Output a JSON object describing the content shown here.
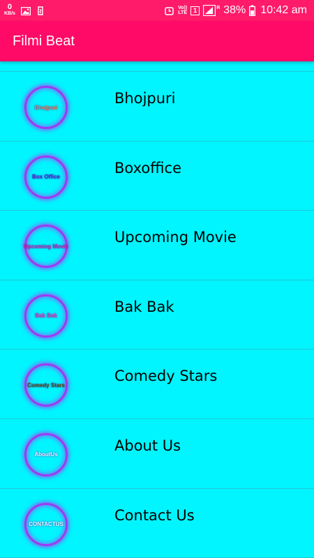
{
  "status_bar": {
    "net_speed_value": "0",
    "net_speed_unit": "KB/s",
    "volte_top": "Vo))",
    "volte_bottom": "LTE",
    "sim": "1",
    "signal_label": "R",
    "battery_percent": "38%",
    "time": "10:42 am"
  },
  "app_bar": {
    "title": "Filmi Beat"
  },
  "menu": [
    {
      "label": "Bhojpuri",
      "logo_text": "Bhojpuri",
      "logo_color": "#ff7a3a"
    },
    {
      "label": "Boxoffice",
      "logo_text": "Box Office",
      "logo_color": "#4a2bd6"
    },
    {
      "label": "Upcoming Movie",
      "logo_text": "Upcoming Movie",
      "logo_color": "#c02cb0"
    },
    {
      "label": "Bak Bak",
      "logo_text": "Bak Bak",
      "logo_color": "#e93fb9"
    },
    {
      "label": "Comedy Stars",
      "logo_text": "Comedy Stars",
      "logo_color": "#5a4a00"
    },
    {
      "label": "About Us",
      "logo_text": "AboutUs",
      "logo_color": "#e8f8ff"
    },
    {
      "label": "Contact Us",
      "logo_text": "CONTACTUS",
      "logo_color": "#e8f8ff"
    }
  ],
  "colors": {
    "status_bar": "#ff1b6a",
    "app_bar": "#ff0a66",
    "list_background": "#00f5ff",
    "logo_ring": "#9b3cf0"
  }
}
